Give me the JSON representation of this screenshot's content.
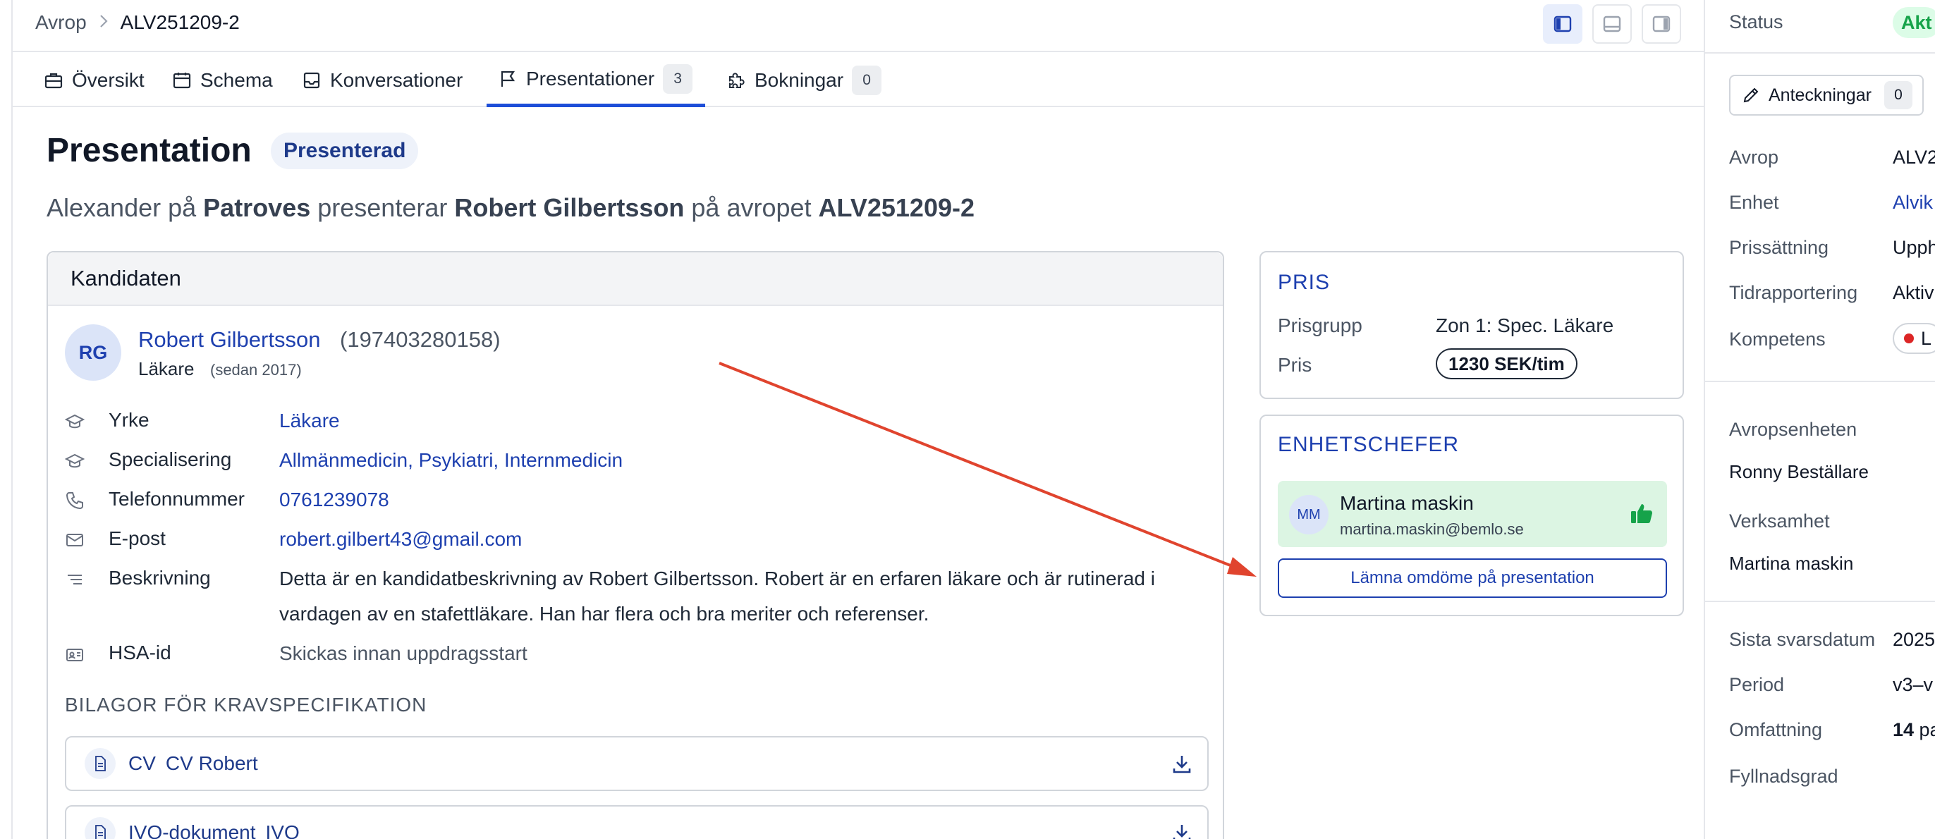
{
  "breadcrumb": {
    "parent": "Avrop",
    "current": "ALV251209-2"
  },
  "tabs": [
    {
      "label": "Översikt",
      "badge": ""
    },
    {
      "label": "Schema",
      "badge": ""
    },
    {
      "label": "Konversationer",
      "badge": ""
    },
    {
      "label": "Presentationer",
      "badge": "3"
    },
    {
      "label": "Bokningar",
      "badge": "0"
    }
  ],
  "presentation": {
    "title": "Presentation",
    "status": "Presenterad",
    "subtitle": {
      "p1": "Alexander på ",
      "company": "Patroves",
      "p2": " presenterar ",
      "candidate": "Robert Gilbertsson",
      "p3": " på avropet ",
      "order": "ALV251209-2"
    }
  },
  "candidate": {
    "header": "Kandidaten",
    "initials": "RG",
    "name": "Robert Gilbertsson",
    "pnr": "(197403280158)",
    "role": "Läkare",
    "since": "(sedan 2017)",
    "fields": {
      "yrke_label": "Yrke",
      "yrke": "Läkare",
      "spec_label": "Specialisering",
      "spec": "Allmänmedicin, Psykiatri, Internmedicin",
      "phone_label": "Telefonnummer",
      "phone": "0761239078",
      "email_label": "E-post",
      "email": "robert.gilbert43@gmail.com",
      "desc_label": "Beskrivning",
      "desc": "Detta är en kandidatbeskrivning av Robert Gilbertsson. Robert är en erfaren läkare och är rutinerad i vardagen av en stafettläkare. Han har flera och bra meriter och referenser.",
      "hsa_label": "HSA-id",
      "hsa": "Skickas innan uppdragsstart"
    },
    "attachments_title": "BILAGOR FÖR KRAVSPECIFIKATION",
    "attachments": [
      {
        "type": "CV",
        "name": "CV Robert"
      },
      {
        "type": "IVO-dokument",
        "name": "IVO"
      }
    ]
  },
  "price": {
    "title": "PRIS",
    "group_label": "Prisgrupp",
    "group": "Zon 1: Spec. Läkare",
    "price_label": "Pris",
    "price": "1230 SEK/tim"
  },
  "managers": {
    "title": "ENHETSCHEFER",
    "initials": "MM",
    "name": "Martina maskin",
    "email": "martina.maskin@bemlo.se",
    "review_button": "Lämna omdöme på presentation"
  },
  "sidepanel": {
    "status_label": "Status",
    "status": "Akt",
    "notes_label": "Anteckningar",
    "notes_count": "0",
    "avrop_label": "Avrop",
    "avrop": "ALV2",
    "enhet_label": "Enhet",
    "enhet": "Alvik",
    "pris_label": "Prissättning",
    "pris": "Upph",
    "tid_label": "Tidrapportering",
    "tid": "Aktiv",
    "komp_label": "Kompetens",
    "komp": "L",
    "avropsenhet_label": "Avropsenheten",
    "avropsenhet": "Ronny Beställare",
    "verksamhet_label": "Verksamhet",
    "verksamhet": "Martina maskin",
    "svar_label": "Sista svarsdatum",
    "svar": "2025",
    "period_label": "Period",
    "period": "v3–v",
    "omf_label": "Omfattning",
    "omf_num": "14",
    "omf_rest": " pa",
    "fyll_label": "Fyllnadsgrad"
  },
  "colors": {
    "accent": "#1e40af",
    "arrow": "#e0442e",
    "success": "#16a34a"
  }
}
